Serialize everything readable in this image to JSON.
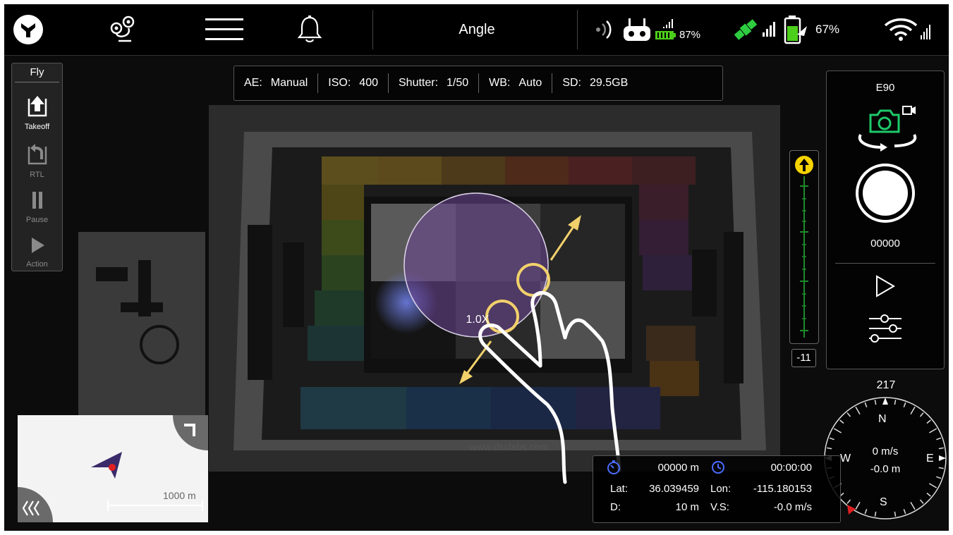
{
  "topbar": {
    "mode_title": "Angle",
    "rc_battery": "87%",
    "aircraft_battery": "67%",
    "icons": [
      "app-logo-icon",
      "map-pins-icon",
      "menu-icon",
      "bell-icon",
      "signal-waves-icon",
      "remote-controller-icon",
      "signal-bars-icon",
      "gps-satellite-icon",
      "battery-icon",
      "wifi-icon"
    ]
  },
  "camera_info": {
    "ae_label": "AE:",
    "ae_value": "Manual",
    "iso_label": "ISO:",
    "iso_value": "400",
    "shutter_label": "Shutter:",
    "shutter_value": "1/50",
    "wb_label": "WB:",
    "wb_value": "Auto",
    "sd_label": "SD:",
    "sd_value": "29.5GB"
  },
  "fly_panel": {
    "title": "Fly",
    "items": [
      {
        "label": "Takeoff",
        "enabled": true
      },
      {
        "label": "RTL",
        "enabled": false
      },
      {
        "label": "Pause",
        "enabled": false
      },
      {
        "label": "Action",
        "enabled": false
      }
    ]
  },
  "camera_panel": {
    "camera_model": "E90",
    "counter": "00000",
    "camera_icon_color": "#1ec96a"
  },
  "zoom": {
    "level": "1.0X"
  },
  "altitude": {
    "value": "-11"
  },
  "compass": {
    "heading": "217",
    "n": "N",
    "s": "S",
    "e": "E",
    "w": "W",
    "speed": "0 m/s",
    "height": "-0.0 m"
  },
  "telemetry": {
    "distance_home": "00000 m",
    "flight_time": "00:00:00",
    "lat_label": "Lat:",
    "lat": "36.039459",
    "lon_label": "Lon:",
    "lon": "-115.180153",
    "d_label": "D:",
    "d": "10 m",
    "vs_label": "V.S:",
    "vs": "-0.0 m/s"
  },
  "minimap": {
    "scale": "1000 m"
  },
  "colors": {
    "accent_yellow": "#f2d16b",
    "gps_green": "#2ecc40",
    "heading_red": "#e02020"
  }
}
